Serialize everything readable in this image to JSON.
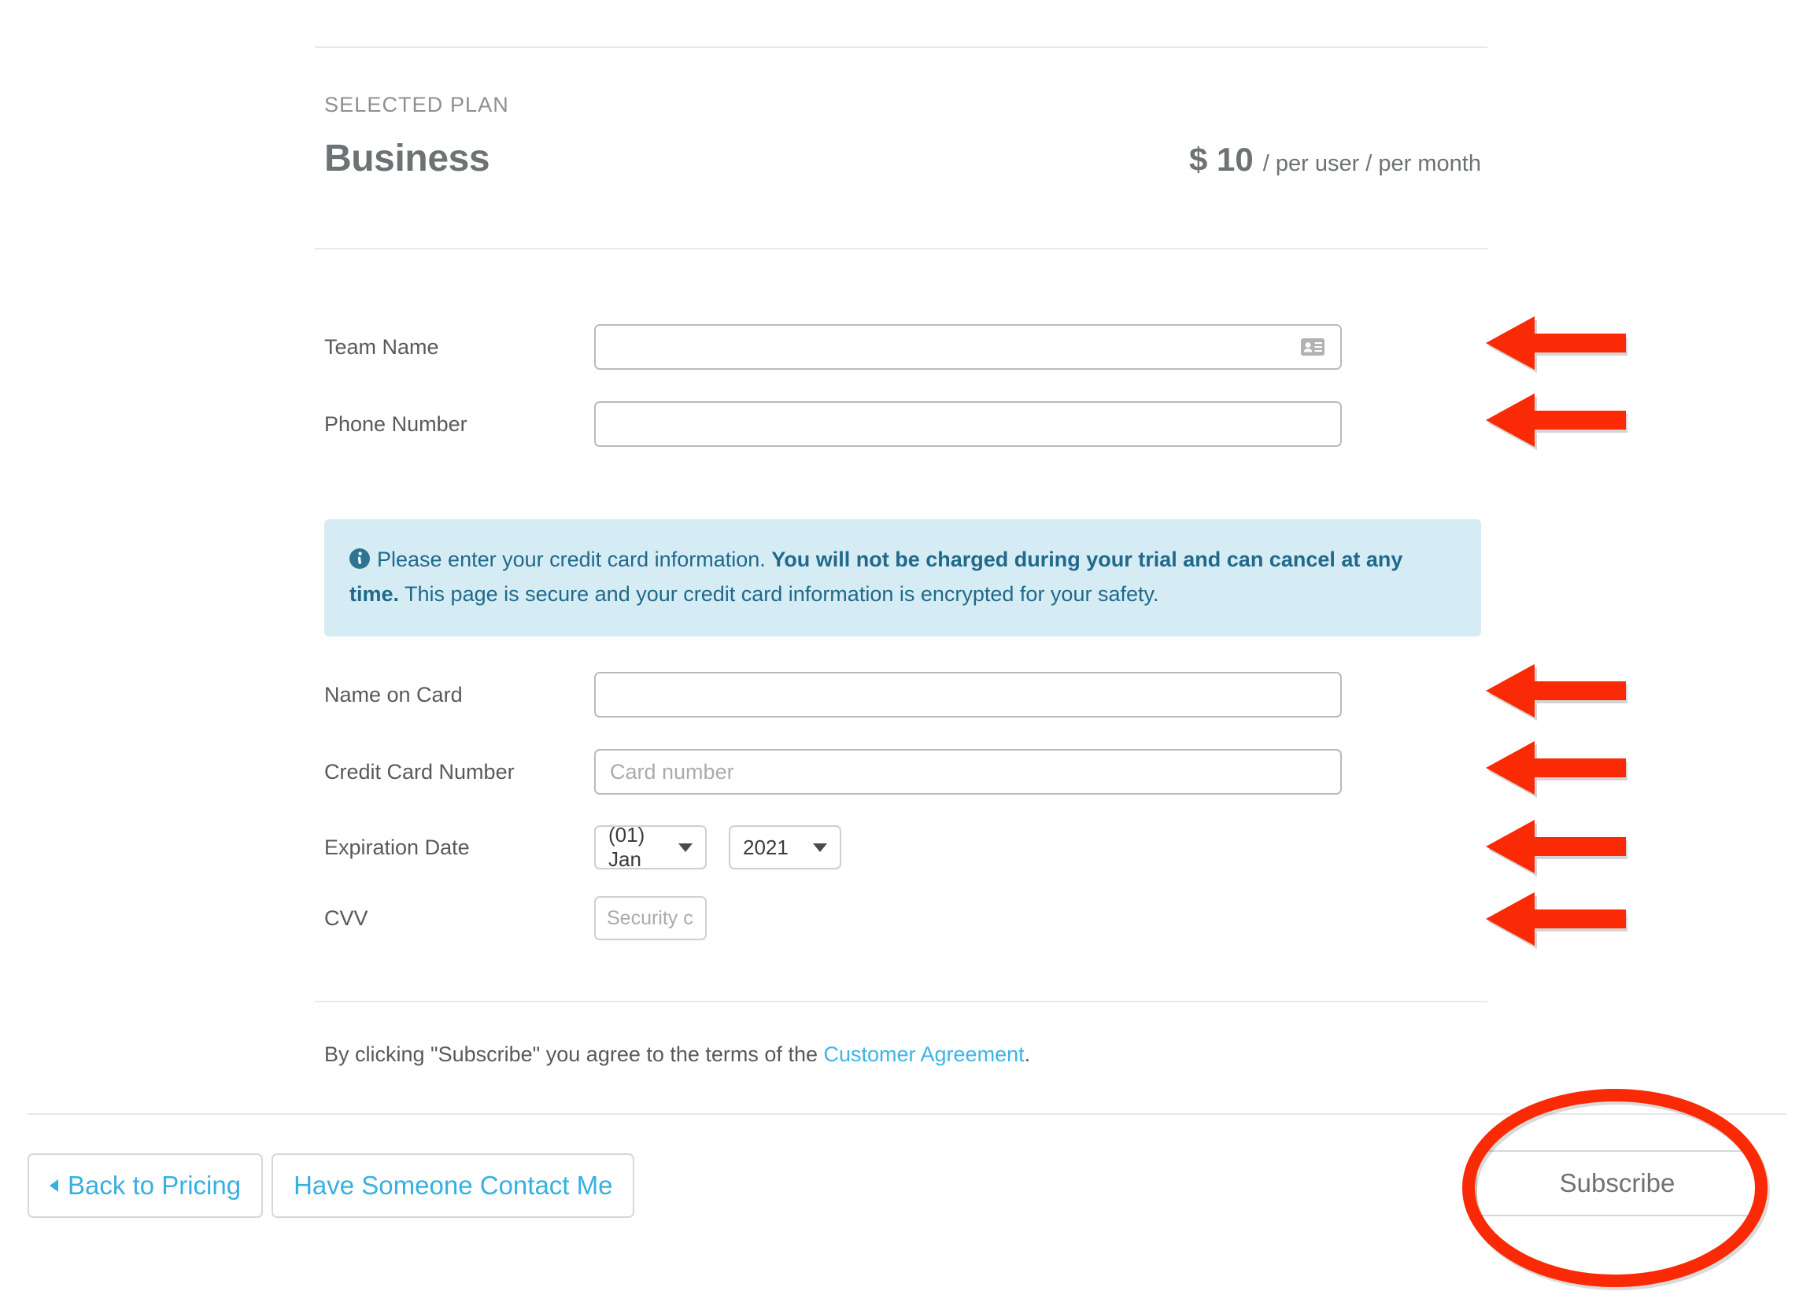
{
  "plan": {
    "section_label": "SELECTED PLAN",
    "name": "Business",
    "price": "$ 10",
    "price_unit": "/ per user / per month"
  },
  "form": {
    "team_name": {
      "label": "Team Name",
      "value": "",
      "placeholder": "",
      "icon": "contact-card-icon"
    },
    "phone_number": {
      "label": "Phone Number",
      "value": "",
      "placeholder": ""
    },
    "name_on_card": {
      "label": "Name on Card",
      "value": "",
      "placeholder": ""
    },
    "credit_card_number": {
      "label": "Credit Card Number",
      "value": "",
      "placeholder": "Card number"
    },
    "expiration_date": {
      "label": "Expiration Date",
      "month_value": "(01) Jan",
      "year_value": "2021"
    },
    "cvv": {
      "label": "CVV",
      "value": "",
      "placeholder": "Security code"
    }
  },
  "info_banner": {
    "icon": "info-circle-icon",
    "text_part1": "Please enter your credit card information. ",
    "text_bold": "You will not be charged during your trial and can cancel at any time.",
    "text_part2": " This page is secure and your credit card information is encrypted for your safety."
  },
  "agreement": {
    "text_before": "By clicking \"Subscribe\" you agree to the terms of the ",
    "link_text": "Customer Agreement",
    "text_after": "."
  },
  "footer": {
    "back_label": "Back to Pricing",
    "contact_label": "Have Someone Contact Me",
    "subscribe_label": "Subscribe"
  },
  "annotations": {
    "arrow_color": "#f92a05",
    "ellipse_color": "#f92a05",
    "arrow_count": 6,
    "ellipse_target": "subscribe-button"
  },
  "colors": {
    "link": "#3cb4e5",
    "label_text": "#58595b",
    "plan_text": "#6d7275",
    "banner_bg": "#d5ecf5",
    "banner_text": "#20698a",
    "border": "#b9babb",
    "divider": "#e8e8e8"
  }
}
